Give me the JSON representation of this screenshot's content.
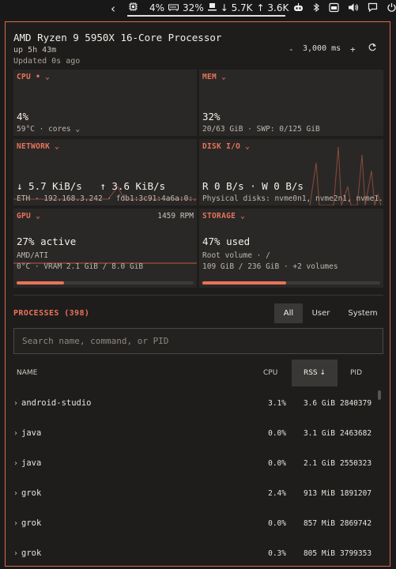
{
  "topbar": {
    "back": "‹",
    "cpu_icon": "cpu-icon",
    "cpu": "4%",
    "mem_icon": "memory-icon",
    "mem": "32%",
    "net_icon": "network-icon",
    "down": "↓ 5.7K",
    "up": "↑ 3.6K",
    "tray": [
      "robot-icon",
      "bluetooth-icon",
      "window-icon",
      "volume-icon",
      "chat-icon",
      "power-icon"
    ]
  },
  "header": {
    "title": "AMD Ryzen 9 5950X 16-Core Processor",
    "uptime": "up 5h 43m",
    "updated": "Updated 0s ago",
    "minus": "-",
    "interval": "3,000 ms",
    "plus": "+",
    "refresh_icon": "refresh-icon"
  },
  "cards": {
    "cpu": {
      "label": "CPU • ⌄",
      "value": "4%",
      "sub": "59°C · cores ⌄"
    },
    "mem": {
      "label": "MEM ⌄",
      "value": "32%",
      "sub": "20/63 GiB · SWP: 0/125 GiB"
    },
    "network": {
      "label": "NETWORK ⌄",
      "value": "↓ 5.7 KiB/s   ↑ 3.6 KiB/s",
      "sub": "ETH · 192.168.3.242 · fdb1:3c91:4a6a:0:..."
    },
    "disk": {
      "label": "DISK I/O ⌄",
      "value": "R 0 B/s · W 0 B/s",
      "sub": "Physical disks: nvme0n1, nvme2n1, nvme1..."
    },
    "gpu": {
      "label": "GPU ⌄",
      "right": "1459 RPM",
      "value": "27% active",
      "sub1": "AMD/ATI",
      "sub2": "0°C · VRAM 2.1 GiB / 8.0 GiB",
      "usage": 0.27
    },
    "storage": {
      "label": "STORAGE ⌄",
      "value": "47% used",
      "sub1": "Root volume · /",
      "sub2": "109 GiB / 236 GiB · +2 volumes",
      "usage": 0.47
    }
  },
  "processes": {
    "title": "PROCESSES (398)",
    "filters": [
      "All",
      "User",
      "System"
    ],
    "active_filter": "All",
    "search_placeholder": "Search name, command, or PID",
    "columns": {
      "name": "NAME",
      "cpu": "CPU",
      "rss": "RSS ↓",
      "pid": "PID"
    },
    "rows": [
      {
        "name": "android-studio",
        "cpu": "3.1%",
        "rss": "3.6 GiB",
        "pid": "2840379"
      },
      {
        "name": "java",
        "cpu": "0.0%",
        "rss": "3.1 GiB",
        "pid": "2463682"
      },
      {
        "name": "java",
        "cpu": "0.0%",
        "rss": "2.1 GiB",
        "pid": "2550323"
      },
      {
        "name": "grok",
        "cpu": "2.4%",
        "rss": "913 MiB",
        "pid": "1891207"
      },
      {
        "name": "grok",
        "cpu": "0.0%",
        "rss": "857 MiB",
        "pid": "2869742"
      },
      {
        "name": "grok",
        "cpu": "0.3%",
        "rss": "805 MiB",
        "pid": "3799353"
      }
    ]
  },
  "colors": {
    "accent": "#e8735a",
    "card": "#2a2826",
    "bg": "#1f1d1c",
    "border": "#d96a4d"
  }
}
